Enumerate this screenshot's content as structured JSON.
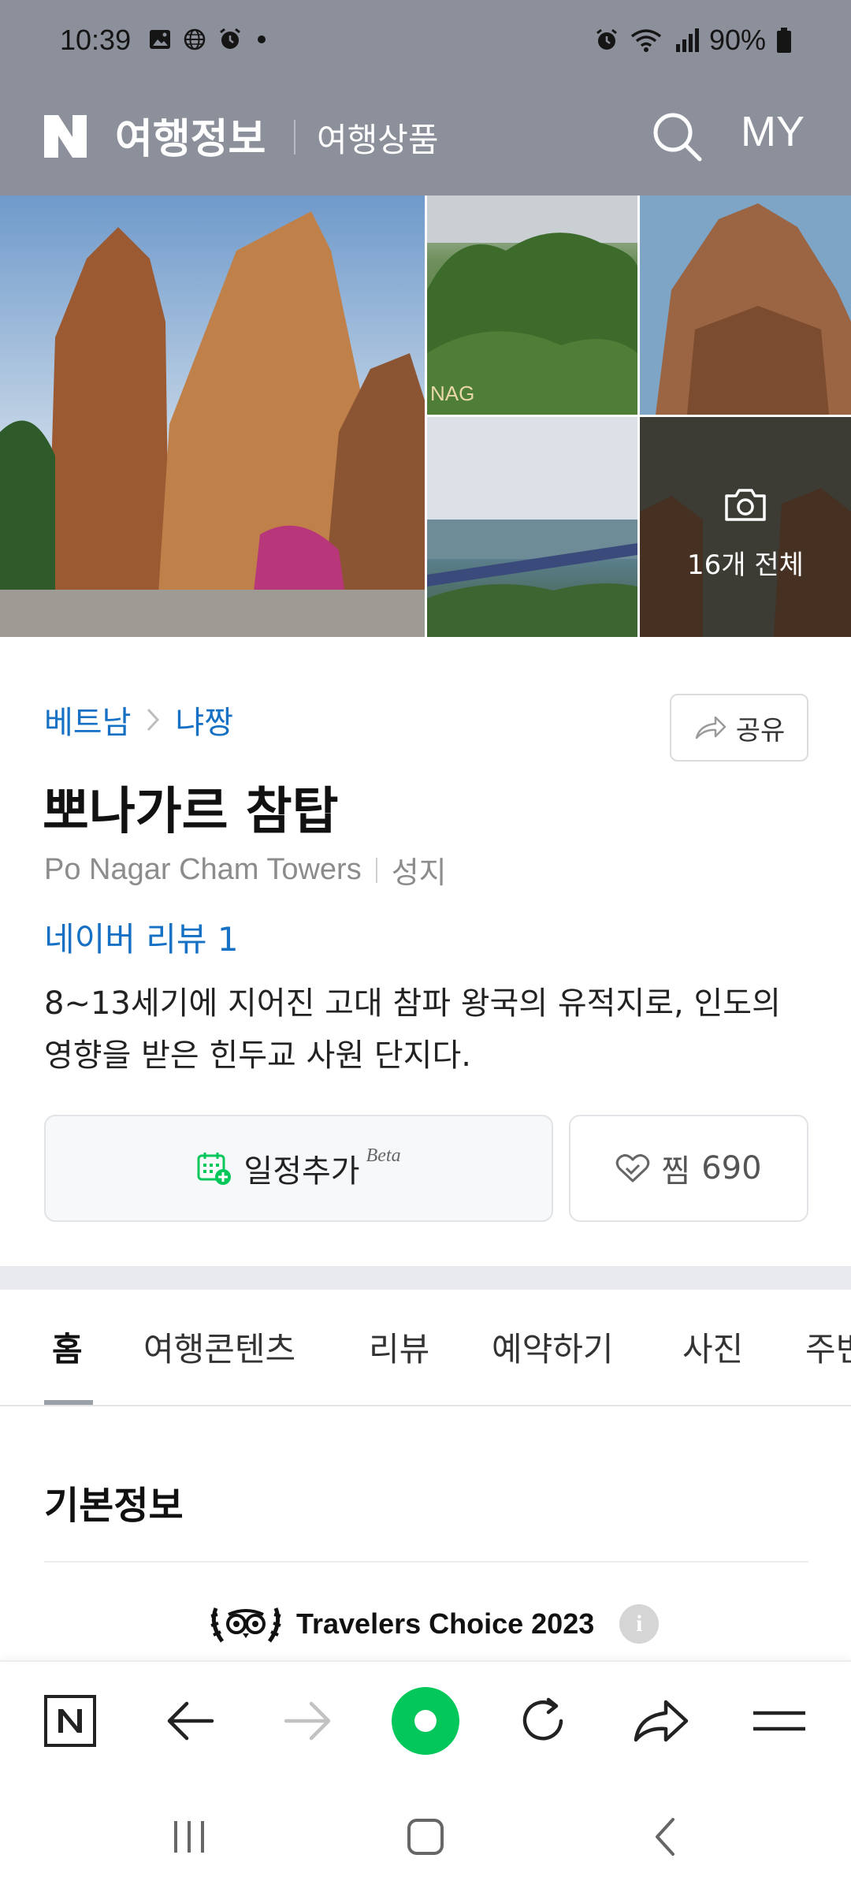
{
  "status_bar": {
    "time": "10:39",
    "battery": "90%",
    "left_icons": [
      "gallery-icon",
      "globe-icon",
      "alarm-icon",
      "dot"
    ],
    "right_icons": [
      "alarm-icon",
      "wifi-icon",
      "signal-icon",
      "battery-icon"
    ]
  },
  "header": {
    "logo": "N",
    "title": "여행정보",
    "subtitle": "여행상품",
    "my_label": "MY"
  },
  "gallery": {
    "all_photos_label": "16개 전체"
  },
  "place": {
    "breadcrumb": [
      "베트남",
      "냐짱"
    ],
    "share_label": "공유",
    "name": "뽀나가르 참탑",
    "name_en": "Po Nagar Cham Towers",
    "category": "성지",
    "review_link": "네이버 리뷰 1",
    "description": "8~13세기에 지어진 고대 참파 왕국의 유적지로, 인도의 영향을 받은 힌두교 사원 단지다.",
    "schedule_label": "일정추가",
    "beta_label": "Beta",
    "save_label": "찜",
    "save_count": "690"
  },
  "tabs": [
    {
      "label": "홈",
      "active": true
    },
    {
      "label": "여행콘텐츠",
      "active": false
    },
    {
      "label": "리뷰",
      "active": false
    },
    {
      "label": "예약하기",
      "active": false
    },
    {
      "label": "사진",
      "active": false
    },
    {
      "label": "주변",
      "active": false
    }
  ],
  "basic_info": {
    "title": "기본정보",
    "award": "Travelers Choice 2023"
  },
  "colors": {
    "accent_blue": "#1670c3",
    "header_bg": "#8c909b",
    "naver_green": "#03c75a"
  }
}
